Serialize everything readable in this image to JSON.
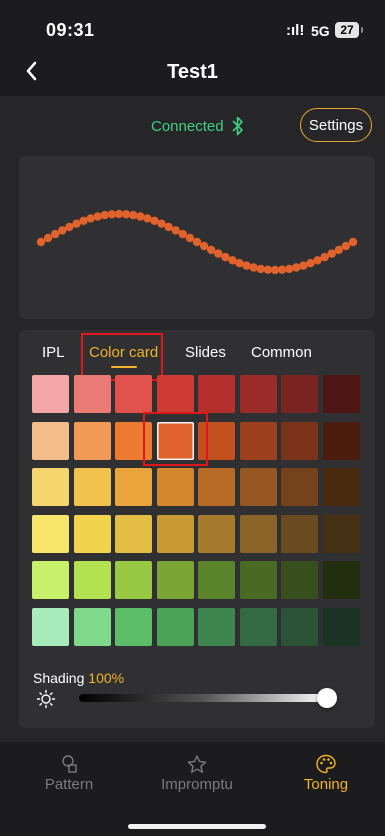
{
  "status": {
    "time": "09:31",
    "signal": ":ıl!",
    "network": "5G",
    "battery": "27"
  },
  "nav": {
    "back_icon": "chevron-left-icon",
    "title": "Test1"
  },
  "header": {
    "connection": "Connected",
    "bluetooth_icon": "bluetooth-icon",
    "settings_label": "Settings"
  },
  "preview": {
    "led_color": "#e0622d"
  },
  "tabs": [
    {
      "label": "IPL",
      "active": false
    },
    {
      "label": "Color card",
      "active": true
    },
    {
      "label": "Slides",
      "active": false
    },
    {
      "label": "Common",
      "active": false
    }
  ],
  "color_grid": {
    "rows": [
      [
        "#f2a6a8",
        "#ea7a76",
        "#e2524d",
        "#d03a34",
        "#b5302c",
        "#9a2b28",
        "#7a2422",
        "#4d1514"
      ],
      [
        "#f3bd8a",
        "#f09a56",
        "#ec7b2f",
        "#e0622d",
        "#c5501f",
        "#9c401d",
        "#7a3218",
        "#4a1d0e"
      ],
      [
        "#f4d56e",
        "#f2c04c",
        "#e9a43b",
        "#d4862f",
        "#b76b26",
        "#965722",
        "#74431c",
        "#4a2b10"
      ],
      [
        "#f7e46a",
        "#f2d34e",
        "#e4be44",
        "#c79a34",
        "#a67b2d",
        "#8a6428",
        "#6a4b20",
        "#463013"
      ],
      [
        "#c9f06a",
        "#b3e250",
        "#97c944",
        "#7aa635",
        "#5a8429",
        "#4a6a24",
        "#384f1d",
        "#222f0f"
      ],
      [
        "#a8ecbb",
        "#7fd98b",
        "#5cbd69",
        "#4ba35a",
        "#3e8550",
        "#336a43",
        "#2a5337",
        "#1b3322"
      ]
    ],
    "selected": "#e0622d"
  },
  "shading": {
    "label": "Shading",
    "value": "100%",
    "level": 1.0,
    "icon": "brightness-icon"
  },
  "tabbar": [
    {
      "label": "Pattern",
      "icon": "pattern-icon",
      "active": false
    },
    {
      "label": "Impromptu",
      "icon": "impromptu-icon",
      "active": false
    },
    {
      "label": "Toning",
      "icon": "palette-icon",
      "active": true
    }
  ]
}
